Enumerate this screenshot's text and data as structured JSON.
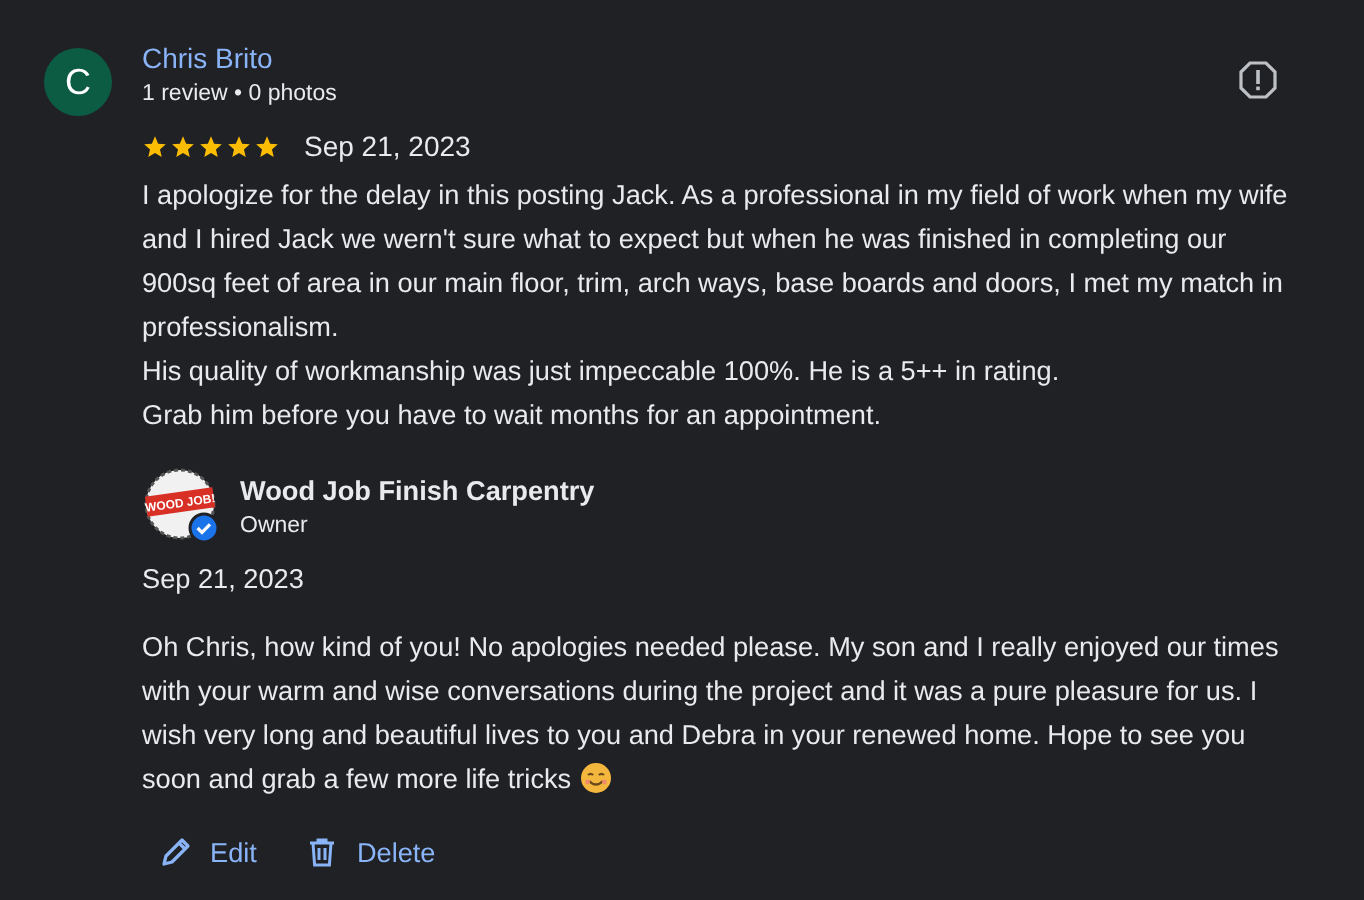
{
  "review": {
    "author_initial": "C",
    "author_name": "Chris Brito",
    "author_meta": "1 review • 0 photos",
    "stars": 5,
    "date": "Sep 21, 2023",
    "paragraphs": [
      "I apologize for the delay in this posting Jack. As a professional in my field of work when my wife and I hired Jack we wern't sure what to expect but when he was finished in completing our 900sq feet of area in our main floor, trim, arch ways, base boards and doors, I met my match in professionalism.",
      "His quality of workmanship was just impeccable 100%. He is a 5++ in rating.",
      "Grab him before you have to wait months for an appointment."
    ]
  },
  "reply": {
    "logo_text": "WOOD JOB!",
    "verified": true,
    "owner_name": "Wood Job Finish Carpentry",
    "role": "Owner",
    "date": "Sep 21, 2023",
    "text": "Oh Chris, how kind of you! No apologies needed please. My son and I really enjoyed our times with your warm and wise conversations during the project and it was a pure pleasure for us. I wish very long and beautiful lives to you and Debra in your renewed home. Hope to see you soon and grab a few more life tricks"
  },
  "actions": [
    {
      "kind": "edit",
      "label": "Edit"
    },
    {
      "kind": "delete",
      "label": "Delete"
    }
  ]
}
